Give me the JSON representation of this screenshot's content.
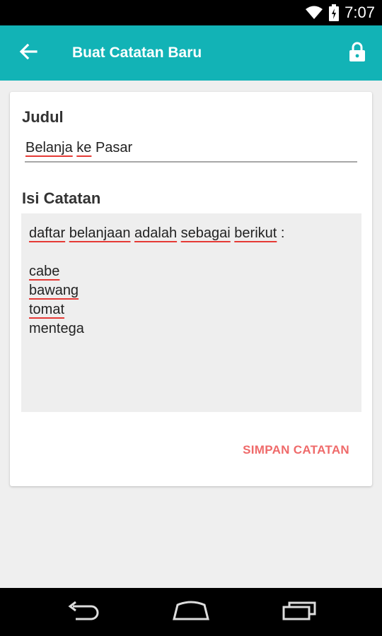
{
  "status_bar": {
    "time": "7:07"
  },
  "app_bar": {
    "title": "Buat Catatan Baru"
  },
  "form": {
    "title_label": "Judul",
    "title_value": "Belanja ke Pasar",
    "body_label": "Isi Catatan",
    "body_lines": [
      "daftar belanjaan adalah sebagai berikut :",
      "",
      "cabe",
      "bawang",
      "tomat",
      "mentega"
    ],
    "save_label": "SIMPAN CATATAN"
  },
  "colors": {
    "accent": "#12b3b6",
    "save_text": "#ef6a6a",
    "spellcheck": "#e53935"
  },
  "icons": {
    "back": "arrow-left-icon",
    "lock": "lock-icon",
    "wifi": "wifi-icon",
    "battery": "battery-icon",
    "nav_back": "nav-back-icon",
    "nav_home": "nav-home-icon",
    "nav_recents": "nav-recents-icon"
  }
}
